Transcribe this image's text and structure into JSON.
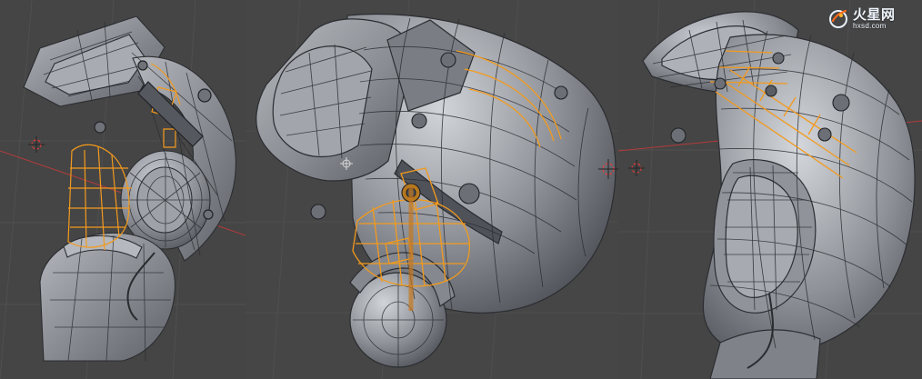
{
  "viewport": {
    "background_color": "#454545",
    "grid_color": "#555555",
    "mesh_fill": "#8a8d93",
    "mesh_dark": "#6e7178",
    "mesh_line": "#2b2d31",
    "selection_color": "#f39a1d",
    "axis_red": "#b33b3b",
    "axis_green": "#5f9b4a"
  },
  "watermark": {
    "title": "火星网",
    "subtitle": "hxsd.com",
    "icon_name": "hxsd-logo-icon"
  }
}
